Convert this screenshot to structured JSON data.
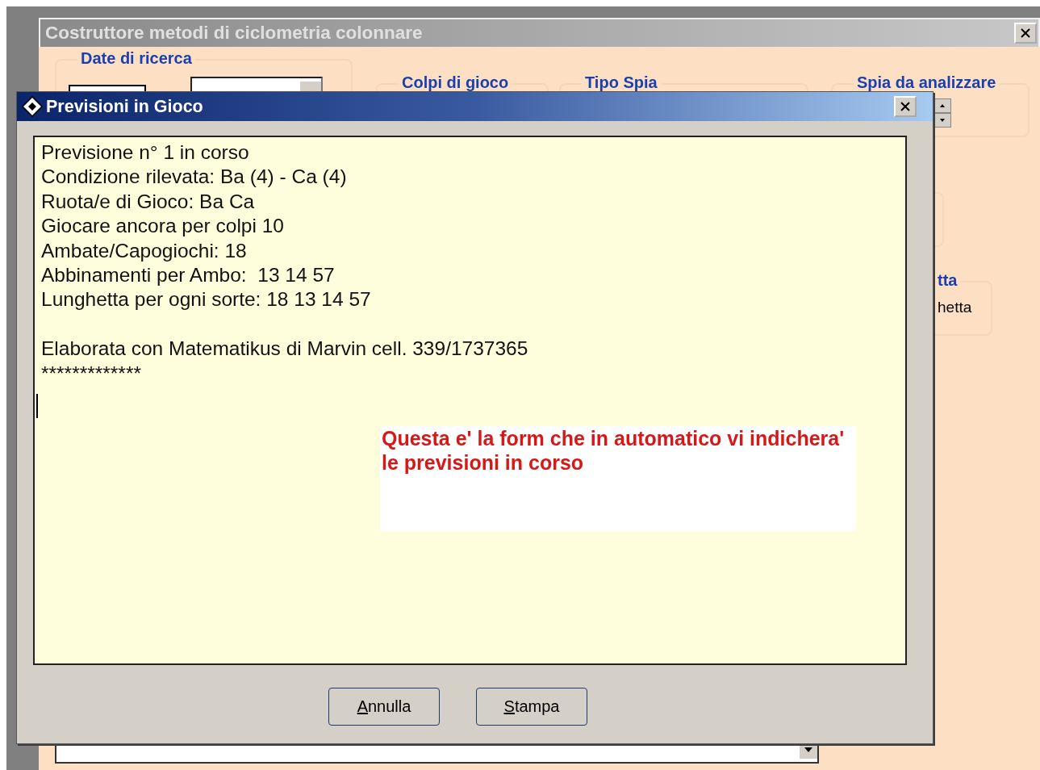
{
  "main_window": {
    "title": "Costruttore metodi di ciclometria colonnare",
    "groups": [
      {
        "kind": "date",
        "label": "Date di ricerca"
      },
      {
        "kind": "plain",
        "label": "Colpi di gioco"
      },
      {
        "kind": "plain",
        "label": "Tipo Spia"
      },
      {
        "kind": "spin",
        "label": "Spia da analizzare"
      },
      {
        "kind": "option",
        "label": "tta",
        "value": "hetta"
      }
    ]
  },
  "dialog": {
    "title": "Previsioni in Gioco",
    "lines": [
      "Previsione n° 1 in corso",
      "Condizione rilevata: Ba (4) - Ca (4)",
      "Ruota/e di Gioco: Ba Ca",
      "Giocare ancora per colpi 10",
      "Ambate/Capogiochi: 18",
      "Abbinamenti per Ambo:  13 14 57",
      "Lunghetta per ogni sorte: 18 13 14 57"
    ],
    "footer_lines": [
      "Elaborata con Matematikus di Marvin cell. 339/1737365",
      "*************"
    ],
    "note": "Questa e' la form che in automatico vi indichera' le previsioni in corso",
    "buttons": [
      {
        "label": "Annulla"
      },
      {
        "label": "Stampa"
      }
    ]
  }
}
